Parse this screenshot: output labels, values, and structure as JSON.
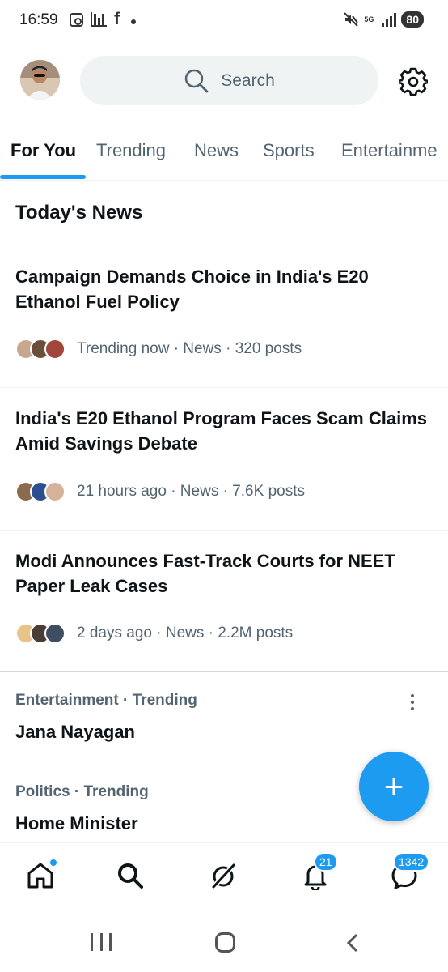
{
  "status_bar": {
    "time": "16:59",
    "network": "5G",
    "battery": "80"
  },
  "header": {
    "search_placeholder": "Search"
  },
  "tabs": [
    {
      "label": "For You"
    },
    {
      "label": "Trending"
    },
    {
      "label": "News"
    },
    {
      "label": "Sports"
    },
    {
      "label": "Entertainme"
    }
  ],
  "section": {
    "title": "Today's News"
  },
  "news": [
    {
      "headline": "Campaign Demands Choice in India's E20 Ethanol Fuel Policy",
      "meta": "Trending now · News · 320 posts"
    },
    {
      "headline": "India's E20 Ethanol Program Faces Scam Claims Amid Savings Debate",
      "meta": "21 hours ago · News · 7.6K posts"
    },
    {
      "headline": "Modi Announces Fast-Track Courts for NEET Paper Leak Cases",
      "meta": "2 days ago · News · 2.2M posts"
    }
  ],
  "trends": [
    {
      "category": "Entertainment · Trending",
      "name": "Jana Nayagan"
    },
    {
      "category": "Politics · Trending",
      "name": "Home Minister"
    }
  ],
  "fab": {
    "label": "+"
  },
  "bottom_nav": {
    "notifications_count": "21",
    "messages_count": "1342"
  },
  "colors": {
    "accent": "#1d9bf0",
    "text_primary": "#0f1419",
    "text_secondary": "#536471",
    "search_bg": "#eff3f4"
  },
  "icons": {
    "home": "home-icon",
    "search": "search-icon",
    "grok": "grok-icon",
    "notifications": "bell-icon",
    "messages": "messages-icon",
    "settings": "gear-icon"
  }
}
